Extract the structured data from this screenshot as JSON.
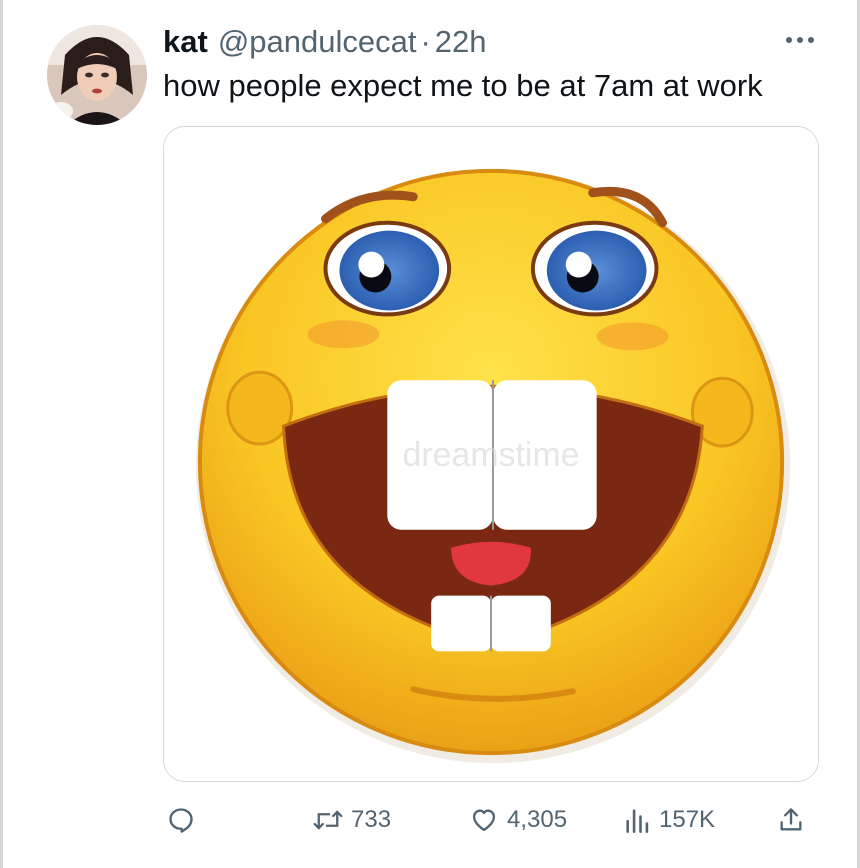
{
  "tweet": {
    "author": {
      "name": "kat",
      "handle": "@pandulcecat",
      "separator": "·",
      "time": "22h"
    },
    "text": "how people expect me to be at 7am at work",
    "more_icon": "more-horizontal-icon",
    "media": {
      "description_icon": "grinning-emoji-image",
      "watermark": "dreamstime"
    },
    "actions": {
      "reply": {
        "icon": "reply-icon",
        "count": ""
      },
      "retweet": {
        "icon": "retweet-icon",
        "count": "733"
      },
      "like": {
        "icon": "heart-icon",
        "count": "4,305"
      },
      "views": {
        "icon": "analytics-icon",
        "count": "157K"
      },
      "share": {
        "icon": "share-icon"
      }
    }
  },
  "colors": {
    "text": "#0f1419",
    "secondary": "#536471",
    "border": "#cfd9de",
    "emoji_yellow": "#f9c623",
    "emoji_mouth": "#7a2812"
  }
}
